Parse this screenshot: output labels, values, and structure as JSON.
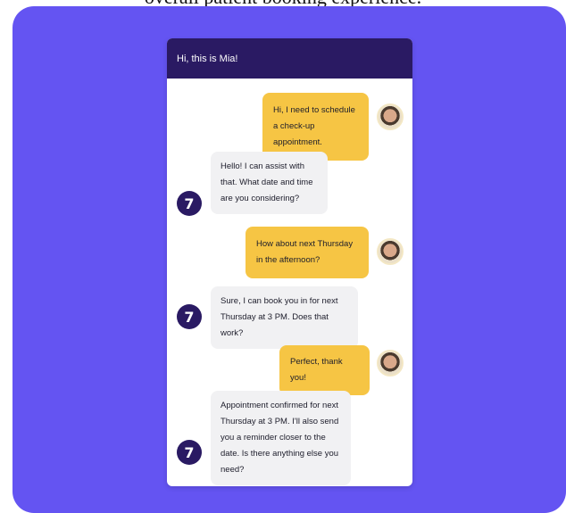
{
  "caption": "overall patient booking experience.",
  "chat": {
    "header_title": "Hi, this is Mia!",
    "bot_logo_glyph": "7",
    "messages": [
      {
        "from": "user",
        "text": "Hi, I need to schedule a check-up appointment."
      },
      {
        "from": "bot",
        "text": "Hello! I can assist with that. What date and time are you considering?"
      },
      {
        "from": "user",
        "text": "How about next Thursday in the afternoon?"
      },
      {
        "from": "bot",
        "text": "Sure, I can book you in for next Thursday at 3 PM. Does that work?"
      },
      {
        "from": "user",
        "text": "Perfect, thank you!"
      },
      {
        "from": "bot",
        "text": "Appointment confirmed for next Thursday at 3 PM. I'll also send you a reminder closer to the date. Is there anything else you need?"
      }
    ]
  },
  "colors": {
    "background_panel": "#6454f2",
    "header": "#2a1a63",
    "user_bubble": "#f6c544",
    "bot_bubble": "#f1f1f3"
  },
  "icons": {
    "user_avatar": "user-avatar-icon",
    "bot_avatar": "bot-logo-icon"
  }
}
